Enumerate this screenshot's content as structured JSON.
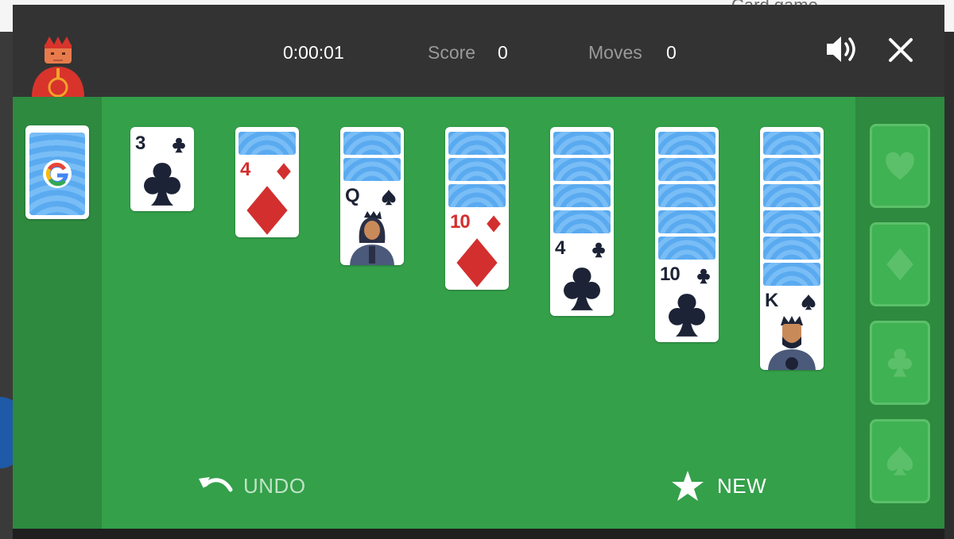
{
  "background": {
    "page_title": "Card game ·"
  },
  "header": {
    "timer": "0:00:01",
    "score_label": "Score",
    "score_value": "0",
    "moves_label": "Moves",
    "moves_value": "0",
    "sound_icon": "speaker-volume-icon",
    "close_icon": "close-icon"
  },
  "stock": {
    "logo": "G"
  },
  "tableau": [
    {
      "rank": "3",
      "suit": "clubs",
      "face_down": 0
    },
    {
      "rank": "4",
      "suit": "diamonds",
      "face_down": 1
    },
    {
      "rank": "Q",
      "suit": "spades",
      "face_down": 2
    },
    {
      "rank": "10",
      "suit": "diamonds",
      "face_down": 3
    },
    {
      "rank": "4",
      "suit": "clubs",
      "face_down": 4
    },
    {
      "rank": "10",
      "suit": "clubs",
      "face_down": 5
    },
    {
      "rank": "K",
      "suit": "spades",
      "face_down": 6
    }
  ],
  "foundations": [
    "hearts",
    "diamonds",
    "clubs",
    "spades"
  ],
  "controls": {
    "undo_label": "UNDO",
    "new_label": "NEW"
  },
  "colors": {
    "board": "#34a04a",
    "side_columns": "#2d8a3f",
    "header": "#333333",
    "red_suit": "#d32f2f",
    "dark_suit": "#1d2336"
  }
}
